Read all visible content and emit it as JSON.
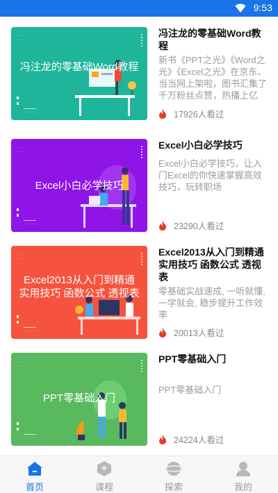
{
  "status_bar": {
    "time": "9:53",
    "icons": [
      "wifi-icon"
    ]
  },
  "courses": [
    {
      "thumb_title": "冯注龙的零基础Word教程",
      "thumb_color": "#1fb59a",
      "title": "冯注龙的零基础Word教程",
      "desc": "新书《PPT之光》《Word之光》《Excel之光》在京东、当当网上架啦，图书汇集了千万粉丝点赞，热播上亿",
      "views": "17926人看过"
    },
    {
      "thumb_title": "Excel小白必学技巧",
      "thumb_color": "#8f14e8",
      "title": "Excel小白必学技巧",
      "desc": "Excel小白必学技巧，让入门Excel的你快速掌握高效技巧，玩转职场",
      "views": "23290人看过"
    },
    {
      "thumb_title": "Excel2013从入门到精通 实用技巧 函数公式 透视表",
      "thumb_color": "#f5533e",
      "title": "Excel2013从入门到精通 实用技巧 函数公式 透视表",
      "desc": "零基础实战速成, 一听就懂, 一学就会, 稳步提升工作效率",
      "views": "20013人看过"
    },
    {
      "thumb_title": "PPT零基础入门",
      "thumb_color": "#58b95f",
      "title": "PPT零基础入门",
      "desc": "PPT零基础入门",
      "views": "24224人看过"
    }
  ],
  "tabbar": {
    "items": [
      {
        "label": "首页",
        "icon": "home-icon",
        "active": true
      },
      {
        "label": "课程",
        "icon": "course-icon",
        "active": false
      },
      {
        "label": "探索",
        "icon": "explore-icon",
        "active": false
      },
      {
        "label": "我的",
        "icon": "profile-icon",
        "active": false
      }
    ]
  },
  "colors": {
    "accent": "#1a73e8",
    "flame": "#e8392c"
  }
}
